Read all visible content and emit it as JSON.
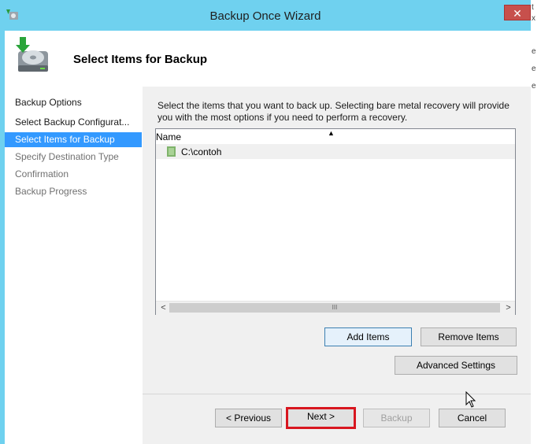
{
  "window": {
    "title": "Backup Once Wizard",
    "close_symbol": "✕",
    "icon": "backup-wizard-icon"
  },
  "header": {
    "title": "Select Items for Backup",
    "icon": "backup-drive-icon"
  },
  "steps": [
    {
      "label": "Backup Options",
      "state": "normal"
    },
    {
      "label": "Select Backup Configurat...",
      "state": "normal"
    },
    {
      "label": "Select Items for Backup",
      "state": "active"
    },
    {
      "label": "Specify Destination Type",
      "state": "disabled"
    },
    {
      "label": "Confirmation",
      "state": "disabled"
    },
    {
      "label": "Backup Progress",
      "state": "disabled"
    }
  ],
  "content": {
    "description": "Select the items that you want to back up. Selecting bare metal recovery will provide you with the most options if you need to perform a recovery.",
    "list": {
      "column_name": "Name",
      "sort_symbol": "▲",
      "rows": [
        {
          "label": "C:\\contoh"
        }
      ],
      "scroll_left": "<",
      "scroll_right": ">",
      "scroll_grip": "III"
    },
    "buttons": {
      "add_items": "Add Items",
      "remove_items": "Remove Items",
      "advanced_settings": "Advanced Settings"
    }
  },
  "footer": {
    "previous": "< Previous",
    "next": "Next >",
    "backup": "Backup",
    "cancel": "Cancel"
  },
  "colors": {
    "titlebar": "#6fd1ef",
    "active_step": "#3399ff",
    "close": "#c7504c",
    "highlight": "#d8161f"
  },
  "background_marks": [
    "t",
    "x",
    "e",
    "e",
    "e"
  ]
}
